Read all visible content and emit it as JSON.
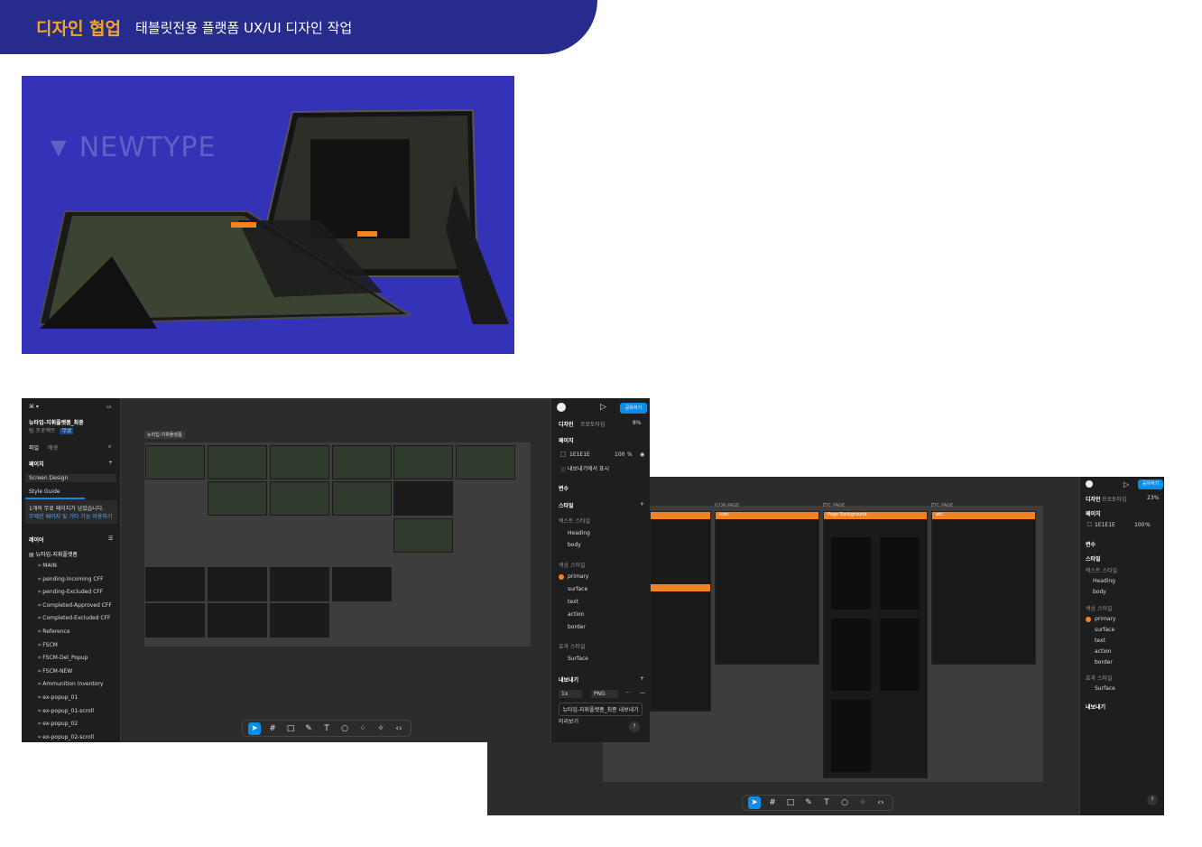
{
  "banner": {
    "title": "디자인 협업",
    "subtitle": "태블릿전용 플랫폼 UX/UI 디자인 작업"
  },
  "hero": {
    "logo_text": "NEWTYPE"
  },
  "figma1": {
    "file_name": "뉴타입-지휘플랫폼_최종",
    "team": "팀 프로젝트",
    "plan_badge": "무료",
    "tabs": [
      "파일",
      "에셋"
    ],
    "pages_label": "페이지",
    "pages": [
      "Screen Design",
      "Style Guide"
    ],
    "notice_line1": "1개의 무료 페이지가 남았습니다.",
    "notice_line2": "무제한 페이지 및 기타 기능 이용하기",
    "layers_label": "레이어",
    "root_layer": "뉴타입-지휘플랫폼",
    "layers": [
      "MAIN",
      "pending-Incoming CFF",
      "pending-Excluded CFF",
      "Completed-Approved CFF",
      "Completed-Excluded CFF",
      "Reference",
      "FSCM",
      "FSCM-Del_Popup",
      "FSCM-NEW",
      "Ammunition Inventory",
      "ex-popup_01",
      "ex-popup_01-scroll",
      "ex-popup_02",
      "ex-popup_02-scroll"
    ],
    "canvas_label": "뉴타입-지휘플랫폼",
    "share_button": "공유하기",
    "right_tabs": [
      "디자인",
      "프로토타입"
    ],
    "zoom": "8%",
    "page_section": "페이지",
    "page_color": "1E1E1E",
    "page_opacity": "100",
    "percent": "%",
    "export_show": "내보내기에서 표시",
    "variables": "변수",
    "styles": "스타일",
    "text_styles": "텍스트 스타일",
    "text_style_items": [
      "Heading",
      "body"
    ],
    "color_styles": "색상 스타일",
    "color_style_items": [
      "primary",
      "surface",
      "text",
      "action",
      "border"
    ],
    "effect_styles": "효과 스타일",
    "effect_style_items": [
      "Surface"
    ],
    "export": "내보내기",
    "export_scale": "1x",
    "export_format": "PNG",
    "export_button": "뉴타입-지휘플랫폼_최종 내보내기",
    "preview": "미리보기",
    "help": "?"
  },
  "figma2": {
    "frames": [
      "ICON PAGE",
      "ETC PAGE",
      "ETC PAGE"
    ],
    "frame_titles": [
      "Icon",
      "Page Background",
      "etc."
    ],
    "share_button": "공유하기",
    "right_tabs": [
      "디자인",
      "프로토타입"
    ],
    "zoom": "23%",
    "page_section": "페이지",
    "page_color": "1E1E1E",
    "page_opacity": "100",
    "percent": "%",
    "variables": "변수",
    "styles": "스타일",
    "text_styles": "텍스트 스타일",
    "text_style_items": [
      "Heading",
      "body"
    ],
    "color_styles": "색상 스타일",
    "color_style_items": [
      "primary",
      "surface",
      "text",
      "action",
      "border"
    ],
    "effect_styles": "효과 스타일",
    "effect_style_items": [
      "Surface"
    ],
    "export": "내보내기",
    "help": "?"
  },
  "colors": {
    "banner": "#272c8c",
    "accent": "#f5a623",
    "orange": "#f5821f",
    "hero_bg": "#3433b8",
    "figma_blue": "#0c8ce9"
  }
}
